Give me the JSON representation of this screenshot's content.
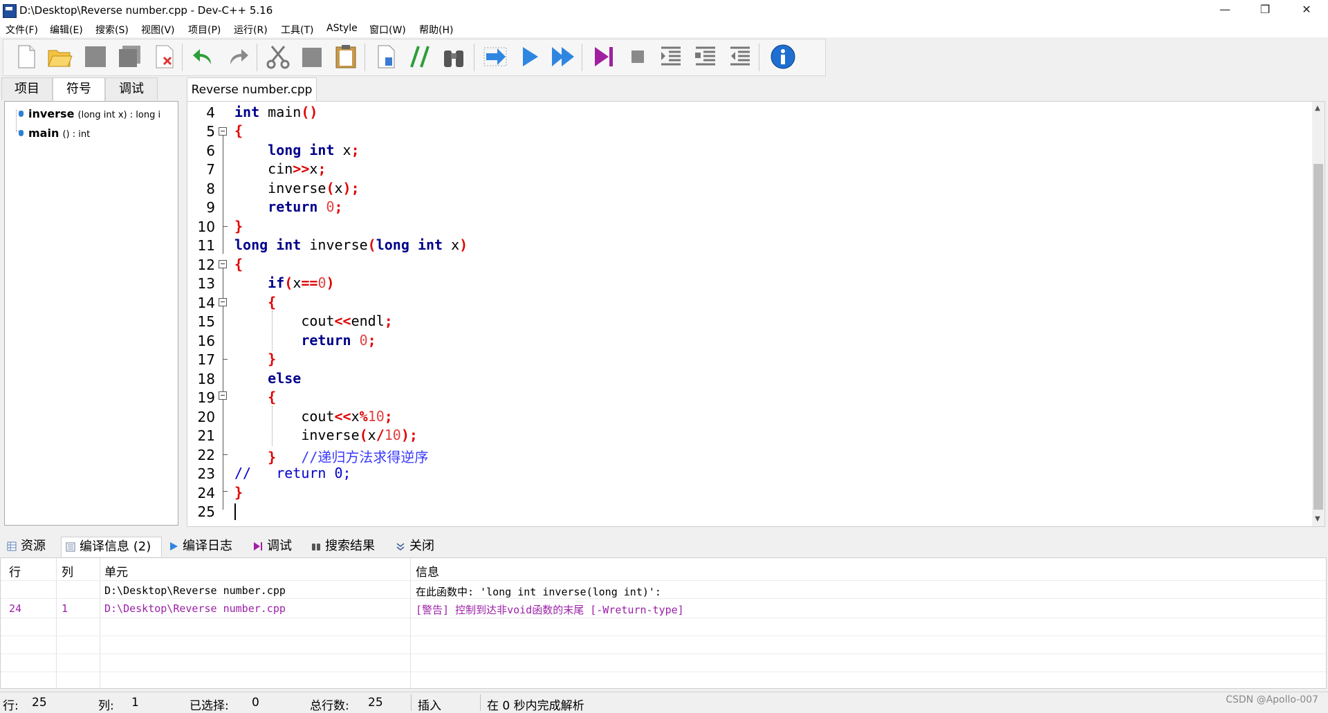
{
  "window": {
    "title": "D:\\Desktop\\Reverse number.cpp - Dev-C++ 5.16",
    "minimize": "—",
    "maximize": "❐",
    "close": "✕"
  },
  "menu": [
    "文件(F)",
    "编辑(E)",
    "搜索(S)",
    "视图(V)",
    "项目(P)",
    "运行(R)",
    "工具(T)",
    "AStyle",
    "窗口(W)",
    "帮助(H)"
  ],
  "left_tabs": [
    "项目",
    "符号",
    "调试"
  ],
  "symbols": [
    {
      "name": "inverse",
      "sig": "(long int x) : long i"
    },
    {
      "name": "main",
      "sig": "() : int"
    }
  ],
  "editor": {
    "tab": "Reverse number.cpp",
    "line_numbers": [
      "4",
      "5",
      "6",
      "7",
      "8",
      "9",
      "10",
      "11",
      "12",
      "13",
      "14",
      "15",
      "16",
      "17",
      "18",
      "19",
      "20",
      "21",
      "22",
      "23",
      "24",
      "25"
    ]
  },
  "bottom_tabs": [
    "资源",
    "编译信息 (2)",
    "编译日志",
    "调试",
    "搜索结果",
    "关闭"
  ],
  "messages": {
    "headers": [
      "行",
      "列",
      "单元",
      "信息"
    ],
    "rows": [
      {
        "line": "",
        "col": "",
        "unit": "D:\\Desktop\\Reverse number.cpp",
        "info": "在此函数中: 'long int inverse(long int)':"
      },
      {
        "line": "24",
        "col": "1",
        "unit": "D:\\Desktop\\Reverse number.cpp",
        "info": "[警告] 控制到达非void函数的末尾 [-Wreturn-type]"
      }
    ]
  },
  "status": {
    "row_label": "行:",
    "row": "25",
    "col_label": "列:",
    "col": "1",
    "sel_label": "已选择:",
    "sel": "0",
    "total_label": "总行数:",
    "total": "25",
    "mode": "插入",
    "parse": "在 0 秒内完成解析"
  },
  "watermark": "CSDN @Apollo-007",
  "colors": {
    "keyword": "#00008b",
    "number": "#e04040",
    "warning": "#9b1fa6",
    "comment": "#3a3aff"
  }
}
